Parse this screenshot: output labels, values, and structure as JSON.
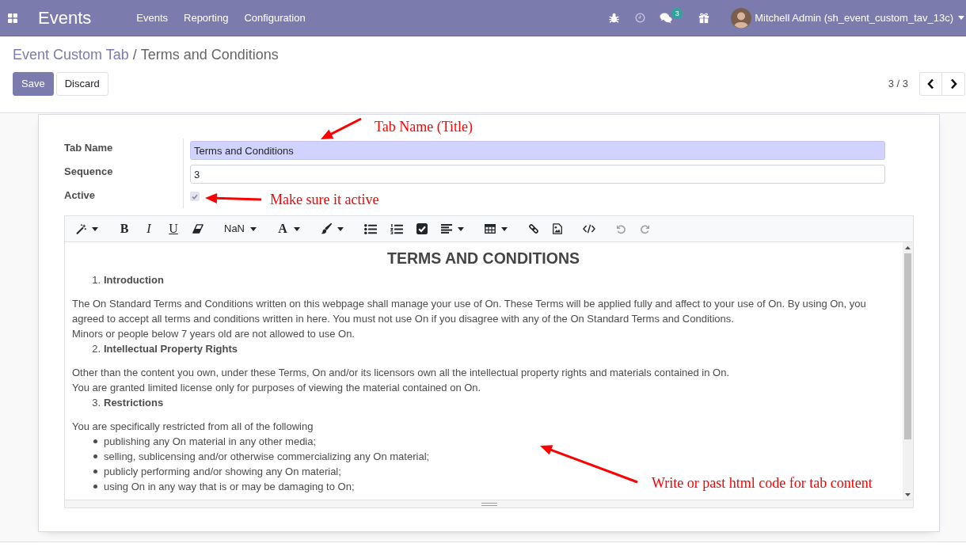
{
  "navbar": {
    "app_name": "Events",
    "menu": [
      "Events",
      "Reporting",
      "Configuration"
    ],
    "messages_badge": "3",
    "user": "Mitchell Admin (sh_event_custom_tav_13c)"
  },
  "control_panel": {
    "breadcrumb": [
      {
        "label": "Event Custom Tab",
        "current": false
      },
      {
        "label": "Terms and Conditions",
        "current": true
      }
    ],
    "breadcrumb_separator": "/",
    "buttons": [
      {
        "label": "Save",
        "kind": "save"
      },
      {
        "label": "Discard",
        "kind": "discard"
      }
    ],
    "pager": "3 / 3"
  },
  "form": {
    "fields": [
      {
        "label": "Tab Name",
        "kind": "text",
        "value": "Terms and Conditions",
        "required": true,
        "annotation": "Tab Name (Title)"
      },
      {
        "label": "Sequence",
        "kind": "text",
        "value": "3",
        "required": false
      },
      {
        "label": "Active",
        "kind": "checkbox",
        "checked": true,
        "annotation": "Make sure it active"
      }
    ],
    "editor": {
      "toolbar": {
        "groups": [
          [
            {
              "kind": "style",
              "dropdown": true,
              "disabled": false
            }
          ],
          [
            {
              "kind": "bold",
              "label": "B",
              "disabled": false
            },
            {
              "kind": "italic",
              "label": "I",
              "disabled": false
            },
            {
              "kind": "underline",
              "label": "U",
              "disabled": false
            },
            {
              "kind": "clear",
              "disabled": false
            }
          ],
          [
            {
              "kind": "fontsize",
              "label": "NaN",
              "dropdown": true,
              "disabled": false
            }
          ],
          [
            {
              "kind": "forecolor",
              "label": "A",
              "dropdown": true,
              "disabled": false
            }
          ],
          [
            {
              "kind": "backcolor",
              "dropdown": true,
              "disabled": false
            }
          ],
          [
            {
              "kind": "bullets",
              "disabled": false
            },
            {
              "kind": "numbers",
              "disabled": false
            },
            {
              "kind": "checklist",
              "disabled": false
            },
            {
              "kind": "align",
              "dropdown": true,
              "disabled": false
            }
          ],
          [
            {
              "kind": "table",
              "dropdown": true,
              "disabled": false
            }
          ],
          [
            {
              "kind": "link",
              "disabled": false
            },
            {
              "kind": "picture",
              "disabled": false
            }
          ],
          [
            {
              "kind": "codeview",
              "disabled": false
            }
          ],
          [
            {
              "kind": "undo",
              "disabled": true
            },
            {
              "kind": "redo",
              "disabled": true
            }
          ]
        ]
      },
      "content": [
        {
          "kind": "heading",
          "text": "TERMS AND CONDITIONS"
        },
        {
          "kind": "numbered",
          "number": "1.",
          "text": "Introduction"
        },
        {
          "kind": "paragraph",
          "lines": [
            "The On Standard Terms and Conditions written on this webpage shall manage your use of On. These Terms will be applied fully and affect to your use of On. By using On, you agreed to accept all terms and conditions written in here. You must not use On if you disagree with any of the On Standard Terms and Conditions.",
            "Minors or people below 7 years old are not allowed to use On."
          ]
        },
        {
          "kind": "numbered",
          "number": "2.",
          "text": "Intellectual Property Rights"
        },
        {
          "kind": "paragraph",
          "lines": [
            "Other than the content you own, under these Terms, On and/or its licensors own all the intellectual property rights and materials contained in On.",
            "You are granted limited license only for purposes of viewing the material contained on On."
          ]
        },
        {
          "kind": "numbered",
          "number": "3.",
          "text": "Restrictions"
        },
        {
          "kind": "paragraph",
          "lines": [
            "You are specifically restricted from all of the following"
          ]
        },
        {
          "kind": "bullet",
          "text": "publishing any On material in any other media;"
        },
        {
          "kind": "bullet",
          "text": "selling, sublicensing and/or otherwise commercializing any On material;"
        },
        {
          "kind": "bullet",
          "text": "publicly performing and/or showing any On material;"
        },
        {
          "kind": "bullet",
          "text": "using On in any way that is or may be damaging to On;"
        }
      ],
      "annotation": "Write or past html code for tab content"
    }
  }
}
